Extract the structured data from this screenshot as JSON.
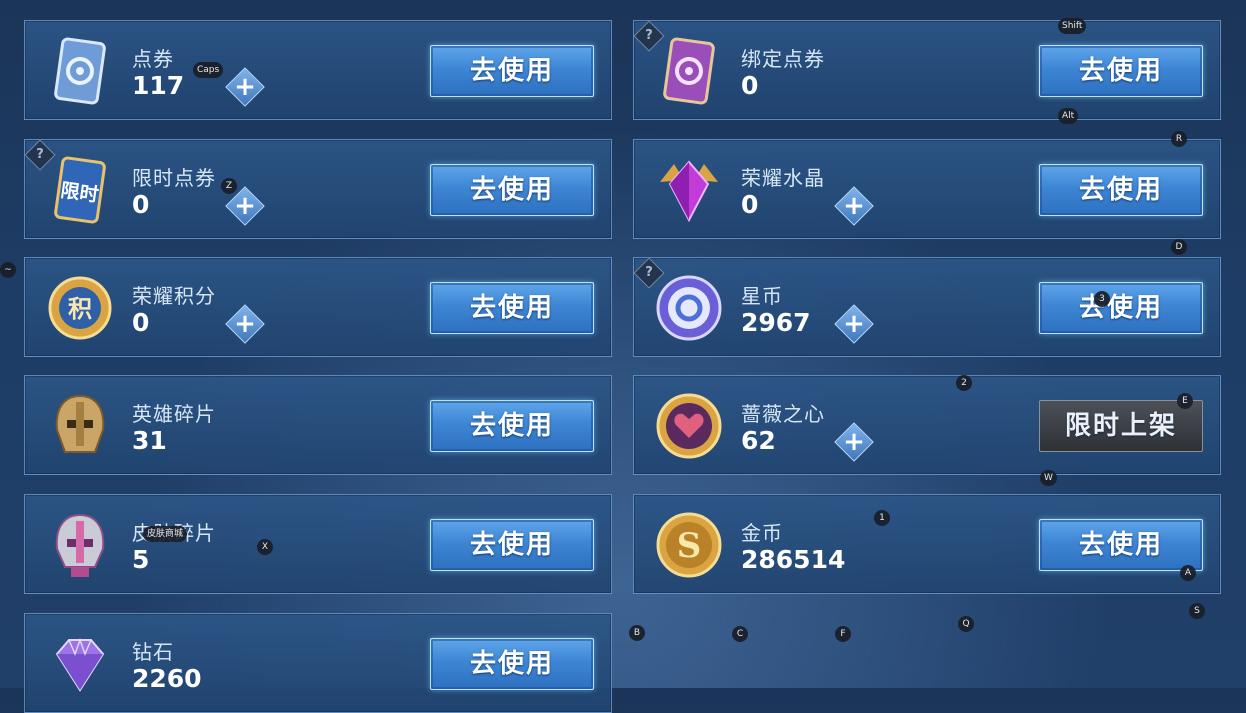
{
  "use_label": "去使用",
  "limited_label": "限时上架",
  "help_glyph": "?",
  "plus_glyph": "+",
  "currencies": [
    {
      "name": "点券",
      "value": "117",
      "icon": "coupon-ticket-icon"
    },
    {
      "name": "绑定点券",
      "value": "0",
      "icon": "bound-coupon-ticket-icon"
    },
    {
      "name": "限时点券",
      "value": "0",
      "icon": "limited-coupon-ticket-icon",
      "icon_text": "限时"
    },
    {
      "name": "荣耀水晶",
      "value": "0",
      "icon": "glory-crystal-icon"
    },
    {
      "name": "荣耀积分",
      "value": "0",
      "icon": "glory-points-icon",
      "icon_text": "积"
    },
    {
      "name": "星币",
      "value": "2967",
      "icon": "star-coin-icon"
    },
    {
      "name": "英雄碎片",
      "value": "31",
      "icon": "hero-fragment-icon"
    },
    {
      "name": "蔷薇之心",
      "value": "62",
      "icon": "rose-heart-icon"
    },
    {
      "name": "皮肤碎片",
      "value": "5",
      "icon": "skin-fragment-icon"
    },
    {
      "name": "金币",
      "value": "286514",
      "icon": "gold-coin-icon",
      "icon_text": "S"
    },
    {
      "name": "钻石",
      "value": "2260",
      "icon": "diamond-icon"
    }
  ],
  "keyboard_hints": [
    "Caps",
    "Shift",
    "Alt",
    "R",
    "Z",
    "D",
    "~",
    "3",
    "2",
    "E",
    "W",
    "1",
    "X",
    "皮肤商城",
    "A",
    "S",
    "Q",
    "B",
    "C",
    "F"
  ],
  "colors": {
    "button_blue": "#3e86d4",
    "button_gray": "#4c5158",
    "card_bg": "#2c5687",
    "coin_gold": "#d9a441",
    "crystal_purple": "#c23cd8"
  }
}
